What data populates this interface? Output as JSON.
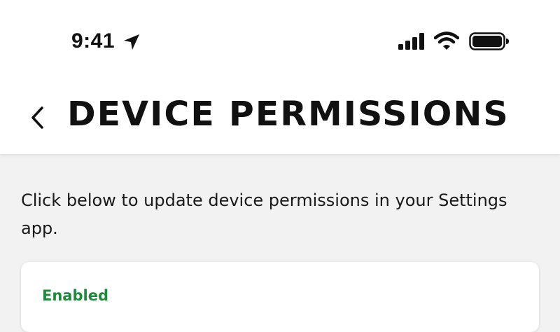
{
  "status_bar": {
    "time": "9:41",
    "icons": [
      "location-arrow-icon",
      "cellular-signal-icon",
      "wifi-icon",
      "battery-icon"
    ]
  },
  "header": {
    "title": "DEVICE PERMISSIONS",
    "back_icon": "chevron-left-icon"
  },
  "main": {
    "description": "Click below to update device permissions in your Settings app.",
    "card": {
      "status": "Enabled"
    }
  },
  "colors": {
    "enabled_green": "#1e8a3c",
    "background": "#f2f2f2",
    "header_bg": "#ffffff"
  }
}
